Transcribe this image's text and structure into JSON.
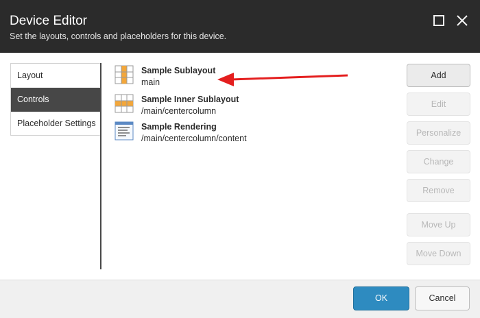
{
  "dialog": {
    "title": "Device Editor",
    "subtitle": "Set the layouts, controls and placeholders for this device."
  },
  "tabs": [
    {
      "label": "Layout"
    },
    {
      "label": "Controls",
      "selected": true
    },
    {
      "label": "Placeholder Settings"
    }
  ],
  "controls": [
    {
      "name": "Sample Sublayout",
      "path": "main",
      "icon": "sublayout-icon"
    },
    {
      "name": "Sample Inner Sublayout",
      "path": "/main/centercolumn",
      "icon": "sublayout-icon"
    },
    {
      "name": "Sample Rendering",
      "path": "/main/centercolumn/content",
      "icon": "rendering-icon"
    }
  ],
  "actions": {
    "add": "Add",
    "edit": "Edit",
    "personalize": "Personalize",
    "change": "Change",
    "remove": "Remove",
    "move_up": "Move Up",
    "move_down": "Move Down"
  },
  "footer": {
    "ok": "OK",
    "cancel": "Cancel"
  },
  "colors": {
    "header_bg": "#2b2b2b",
    "selected_tab_bg": "#474747",
    "ok_button": "#2e8bc0",
    "annotation_arrow": "#e41e1e"
  }
}
